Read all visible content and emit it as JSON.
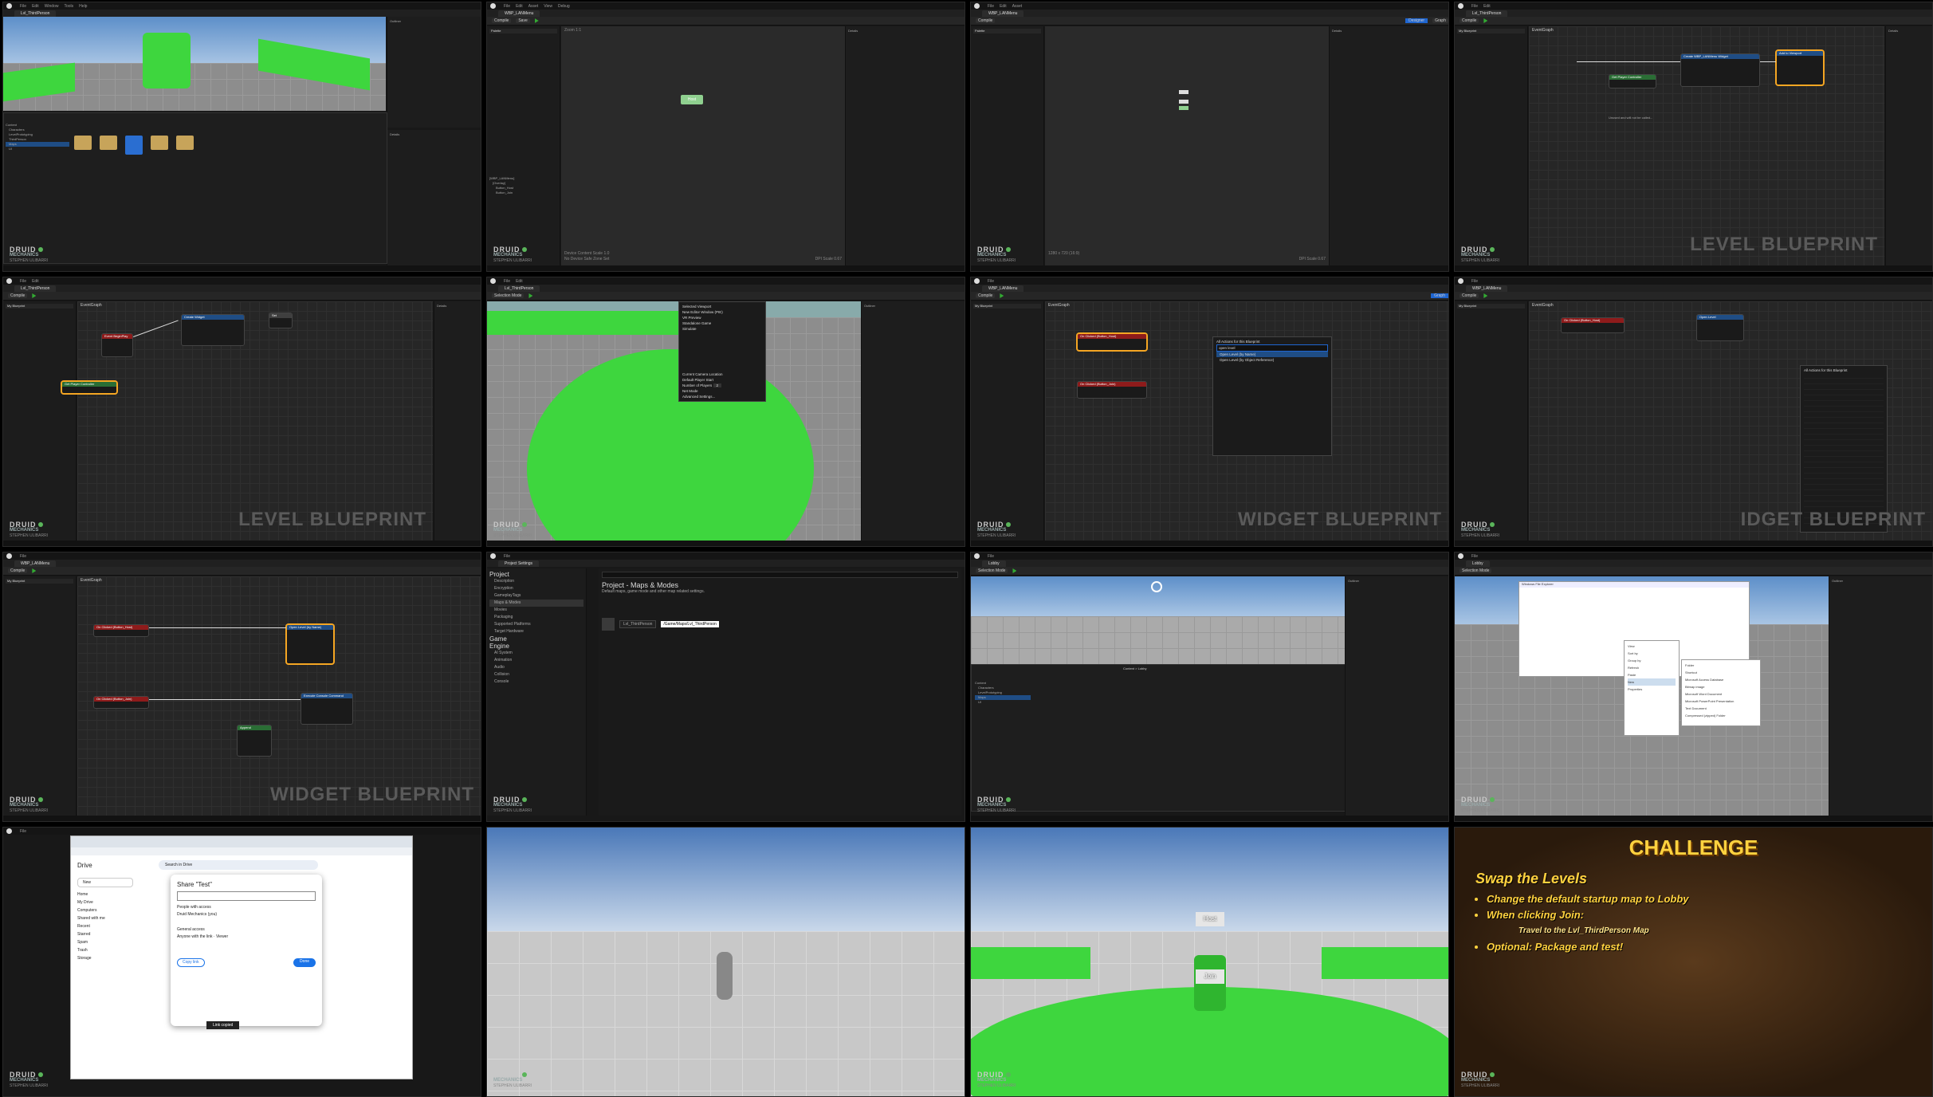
{
  "watermark": {
    "line1": "DRUID",
    "line2": "MECHANICS",
    "line3": "STEPHEN ULIBARRI"
  },
  "menu": [
    "File",
    "Edit",
    "Window",
    "Tools",
    "Help"
  ],
  "level_bp_menu": [
    "File",
    "Edit",
    "Asset",
    "View",
    "Debug",
    "Window",
    "Tools",
    "Help"
  ],
  "cells": {
    "c1": {
      "tab": "Lvl_ThirdPerson",
      "folders": [
        "Content",
        "Characters",
        "LevelPrototyping",
        "ThirdPerson",
        "Maps",
        "UI"
      ],
      "assets": [
        "Characters",
        "LevelPrototyping",
        "ThirdPerson",
        "UI",
        "Lobby"
      ]
    },
    "c2": {
      "tab": "WBP_LANMenu",
      "host": "Host",
      "zoom": "Zoom 1:1",
      "size": "1280 x 720 (16:9)",
      "dpi": "DPI Scale 0.67",
      "safe": "No Device Safe Zone Set",
      "content_scale": "Device Content Scale 1.0",
      "details": "Details",
      "hierarchy": [
        "[WBP_LANMenu]",
        "[Overlay]",
        "Button_Host",
        "Button_Join"
      ]
    },
    "c3": {
      "tab": "WBP_LANMenu",
      "designer": "Designer",
      "graph": "Graph",
      "size": "1280 x 720 (16:9)",
      "dpi": "DPI Scale 0.67"
    },
    "c4": {
      "tab": "Lvl_ThirdPerson",
      "title": "EventGraph",
      "label": "LEVEL BLUEPRINT",
      "node1": "Create WBP_LANMenu Widget",
      "node2": "Add to Viewport",
      "node3": "Get Player Controller",
      "node4": "Set Show Mouse Cursor",
      "comment": "Unused and will not be called..."
    },
    "c5": {
      "tab": "Lvl_ThirdPerson",
      "title": "EventGraph",
      "label": "LEVEL BLUEPRINT",
      "node1": "Event BeginPlay",
      "node2": "Create Widget",
      "node3": "Set",
      "node4": "Get Player Controller"
    },
    "c6": {
      "tab": "Lvl_ThirdPerson",
      "menu": [
        "Selected Viewport",
        "New Editor Window (PIE)",
        "VR Preview",
        "Standalone Game",
        "Simulate",
        "Current Camera Location",
        "Default Player Start",
        "Number of Players",
        "Net Mode",
        "Advanced Settings..."
      ],
      "players": "2"
    },
    "c7": {
      "tab": "WBP_LANMenu",
      "title": "EventGraph",
      "label": "WIDGET BLUEPRINT",
      "node1": "On Clicked (Button_Host)",
      "node2": "On Clicked (Button_Join)",
      "search_title": "All Actions for this Blueprint",
      "search_text": "open level",
      "results": [
        "Open Level (by Name)",
        "Open Level (by Object Reference)"
      ]
    },
    "c8": {
      "tab": "WBP_LANMenu",
      "title": "EventGraph",
      "label": "IDGET BLUEPRINT",
      "node1": "On Clicked (Button_Host)",
      "node2": "Open Level",
      "actions_title": "All Actions for this Blueprint"
    },
    "c9": {
      "tab": "WBP_LANMenu",
      "title": "EventGraph",
      "label": "WIDGET BLUEPRINT",
      "node1": "On Clicked (Button_Host)",
      "node2": "Open Level (by Name)",
      "node3": "On Clicked (Button_Join)",
      "node4": "Execute Console Command",
      "node5": "Append"
    },
    "c10": {
      "title": "Project Settings",
      "heading": "Project - Maps & Modes",
      "desc": "Default maps, game mode and other map related settings.",
      "left": [
        "Project",
        "Description",
        "Encryption",
        "GameplayTags",
        "Maps & Modes",
        "Movies",
        "Packaging",
        "Supported Platforms",
        "Target Hardware",
        "Game",
        "Engine",
        "AI System",
        "Animation",
        "Audio",
        "Collision",
        "Console"
      ],
      "default_map": "Lvl_ThirdPerson",
      "tooltip": "/Game/Maps/Lvl_ThirdPerson"
    },
    "c11": {
      "tab": "Lobby",
      "content": "Content > Lobby",
      "folders": [
        "Content",
        "Characters",
        "LevelPrototyping",
        "Maps",
        "UI"
      ]
    },
    "c12": {
      "tab": "Lobby",
      "dialog": "Windows File Explorer",
      "context": [
        "View",
        "Sort by",
        "Group by",
        "Refresh",
        "Paste",
        "New",
        "Properties"
      ],
      "submenu": [
        "Folder",
        "Shortcut",
        "Microsoft Access Database",
        "Bitmap image",
        "Microsoft Word Document",
        "Microsoft PowerPoint Presentation",
        "Text Document",
        "Compressed (zipped) Folder"
      ]
    },
    "c13": {
      "title": "Share \"Test\"",
      "people_label": "People with access",
      "person": "Druid Mechanics (you)",
      "general": "General access",
      "anyone": "Anyone with the link",
      "viewer": "Viewer",
      "copy": "Copy link",
      "done": "Done",
      "toast": "Link copied",
      "drive_title": "Drive",
      "search": "Search in Drive",
      "sidebar": [
        "New",
        "Home",
        "My Drive",
        "Computers",
        "Shared with me",
        "Recent",
        "Starred",
        "Spam",
        "Trash",
        "Storage"
      ]
    },
    "c16": {
      "title": "CHALLENGE",
      "subtitle": "Swap the Levels",
      "items": [
        "Change the default startup map to Lobby",
        "When clicking Join:",
        "Optional: Package and test!"
      ],
      "subitem": "Travel to the Lvl_ThirdPerson Map"
    }
  },
  "viewport15": {
    "host": "Host",
    "join": "Join"
  },
  "colors": {
    "accent": "#f5a623",
    "green": "#3ed63e",
    "blue_btn": "#1f66d1",
    "challenge_text": "#ffd23f"
  }
}
